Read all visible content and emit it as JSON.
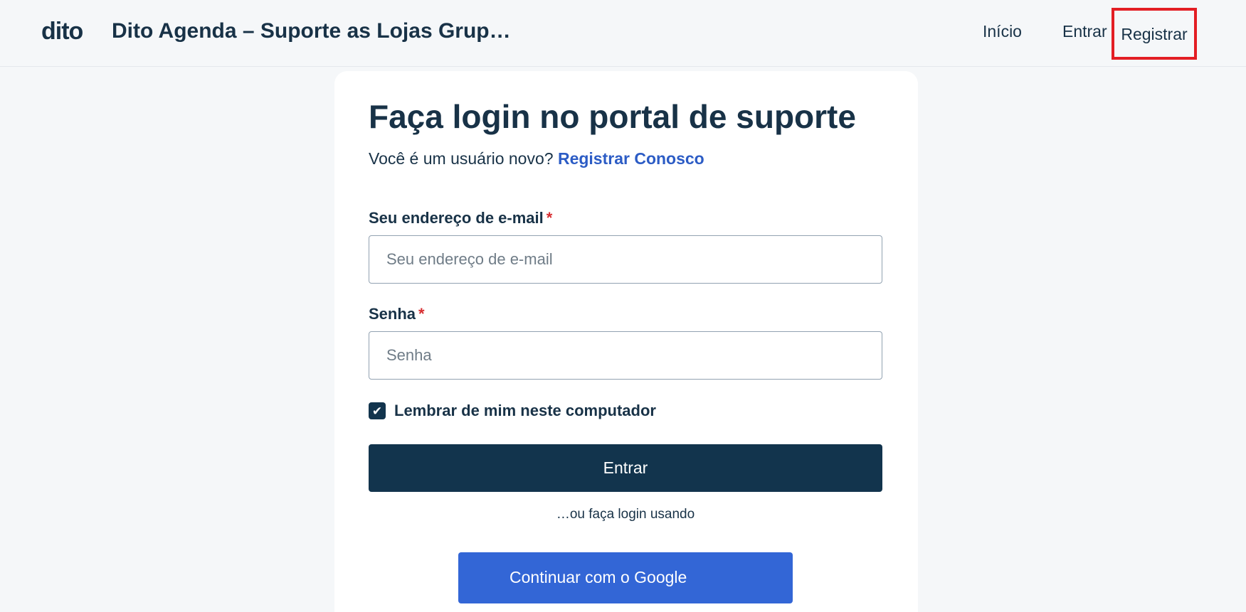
{
  "header": {
    "logo_text": "dito",
    "site_title": "Dito Agenda – Suporte as Lojas Grup…",
    "nav": {
      "inicio": "Início",
      "entrar": "Entrar",
      "registrar": "Registrar"
    },
    "highlight_color": "#e31e24"
  },
  "login": {
    "title": "Faça login no portal de suporte",
    "new_user_text": "Você é um usuário novo?",
    "register_link": "Registrar Conosco",
    "email": {
      "label": "Seu endereço de e-mail",
      "required_mark": "*",
      "placeholder": "Seu endereço de e-mail",
      "value": ""
    },
    "password": {
      "label": "Senha",
      "required_mark": "*",
      "placeholder": "Senha",
      "value": ""
    },
    "remember": {
      "label": "Lembrar de mim neste computador",
      "checked": true
    },
    "submit_label": "Entrar",
    "or_text": "…ou faça login usando",
    "google_label": "Continuar com o Google"
  },
  "colors": {
    "primary_dark": "#12344d",
    "link_blue": "#2c5cc5",
    "google_blue": "#3366d6",
    "required_red": "#d72d30"
  }
}
